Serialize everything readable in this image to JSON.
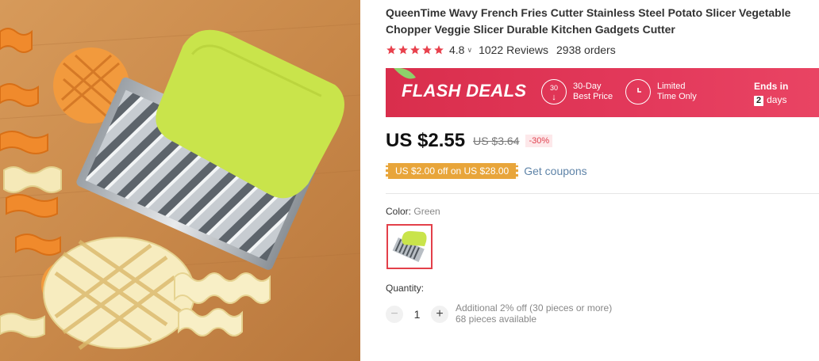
{
  "product": {
    "title": "QueenTime Wavy French Fries Cutter Stainless Steel Potato Slicer Vegetable Chopper Veggie Slicer Durable Kitchen Gadgets Cutter",
    "image_alt": "Green-handled wavy fries cutter on a wooden board with crinkle and waffle fries",
    "rating": "4.8",
    "stars": 5,
    "reviews": "1022 Reviews",
    "orders": "2938 orders"
  },
  "flash": {
    "title": "FLASH DEALS",
    "badge_top": "30",
    "item1_line1": "30-Day",
    "item1_line2": "Best Price",
    "item2_line1": "Limited",
    "item2_line2": "Time Only",
    "ends_label": "Ends in",
    "ends_days_value": "2",
    "ends_days_unit": "days"
  },
  "price": {
    "current": "US $2.55",
    "original": "US $3.64",
    "discount": "-30%"
  },
  "coupon": {
    "label": "US $2.00 off on US $28.00",
    "link": "Get coupons"
  },
  "color": {
    "label": "Color:",
    "value": "Green"
  },
  "quantity": {
    "label": "Quantity:",
    "value": "1",
    "minus": "−",
    "plus": "+",
    "note_line1": "Additional 2% off (30 pieces or more)",
    "note_line2": "68 pieces available"
  },
  "colors": {
    "accent": "#e3395b",
    "coupon": "#e8a53a",
    "star": "#e8414d",
    "link": "#5f84a8",
    "handle": "#c9e44b"
  }
}
